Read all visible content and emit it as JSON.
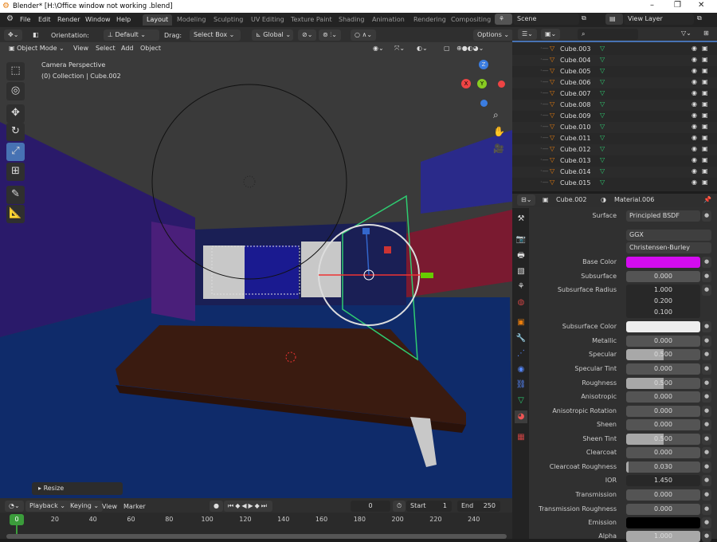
{
  "window": {
    "title": "Blender* [H:\\Office  window not working .blend]",
    "minimize": "–",
    "maximize": "❐",
    "close": "✕"
  },
  "menu": [
    "File",
    "Edit",
    "Render",
    "Window",
    "Help"
  ],
  "workspaces": [
    "Layout",
    "Modeling",
    "Sculpting",
    "UV Editing",
    "Texture Paint",
    "Shading",
    "Animation",
    "Rendering",
    "Compositing"
  ],
  "scene": "Scene",
  "view_layer": "View Layer",
  "header": {
    "orientation_label": "Orientation:",
    "orientation": "Default",
    "drag_label": "Drag:",
    "drag": "Select Box",
    "transform": "Global",
    "options": "Options"
  },
  "viewport_header": {
    "mode": "Object Mode",
    "menus": [
      "View",
      "Select",
      "Add",
      "Object"
    ]
  },
  "viewport": {
    "info_line1": "Camera Perspective",
    "info_line2": "(0) Collection | Cube.002",
    "resize": "Resize",
    "gizmo_x": "X",
    "gizmo_y": "Y",
    "gizmo_z": "Z"
  },
  "outliner": {
    "items": [
      "Cube.003",
      "Cube.004",
      "Cube.005",
      "Cube.006",
      "Cube.007",
      "Cube.008",
      "Cube.009",
      "Cube.010",
      "Cube.011",
      "Cube.012",
      "Cube.013",
      "Cube.014",
      "Cube.015"
    ]
  },
  "properties": {
    "object": "Cube.002",
    "material": "Material.006",
    "surface_label": "Surface",
    "surface": "Principled BSDF",
    "distribution": "GGX",
    "subsurface_method": "Christensen-Burley",
    "base_color": "#d40cf0",
    "subsurface_color": "#eeeeee",
    "emission_color": "#000000",
    "rows": [
      {
        "label": "Subsurface",
        "value": "0.000",
        "fill": 0
      },
      {
        "label": "Metallic",
        "value": "0.000",
        "fill": 0
      },
      {
        "label": "Specular",
        "value": "0.500",
        "fill": 0.5
      },
      {
        "label": "Specular Tint",
        "value": "0.000",
        "fill": 0
      },
      {
        "label": "Roughness",
        "value": "0.500",
        "fill": 0.5
      },
      {
        "label": "Anisotropic",
        "value": "0.000",
        "fill": 0
      },
      {
        "label": "Anisotropic Rotation",
        "value": "0.000",
        "fill": 0
      },
      {
        "label": "Sheen",
        "value": "0.000",
        "fill": 0
      },
      {
        "label": "Sheen Tint",
        "value": "0.500",
        "fill": 0.5
      },
      {
        "label": "Clearcoat",
        "value": "0.000",
        "fill": 0
      },
      {
        "label": "Clearcoat Roughness",
        "value": "0.030",
        "fill": 0.03
      },
      {
        "label": "IOR",
        "value": "1.450",
        "fill": 0
      },
      {
        "label": "Transmission",
        "value": "0.000",
        "fill": 0
      },
      {
        "label": "Transmission Roughness",
        "value": "0.000",
        "fill": 0
      },
      {
        "label": "Alpha",
        "value": "1.000",
        "fill": 1
      }
    ],
    "base_color_label": "Base Color",
    "subsurface_radius_label": "Subsurface Radius",
    "subsurface_radius": [
      "1.000",
      "0.200",
      "0.100"
    ],
    "subsurface_color_label": "Subsurface Color",
    "emission_label": "Emission"
  },
  "timeline": {
    "menus": [
      "Playback",
      "Keying",
      "View",
      "Marker"
    ],
    "current_frame": "0",
    "start_label": "Start",
    "start": "1",
    "end_label": "End",
    "end": "250",
    "ticks": [
      "0",
      "20",
      "40",
      "60",
      "80",
      "100",
      "120",
      "140",
      "160",
      "180",
      "200",
      "220",
      "240"
    ]
  }
}
